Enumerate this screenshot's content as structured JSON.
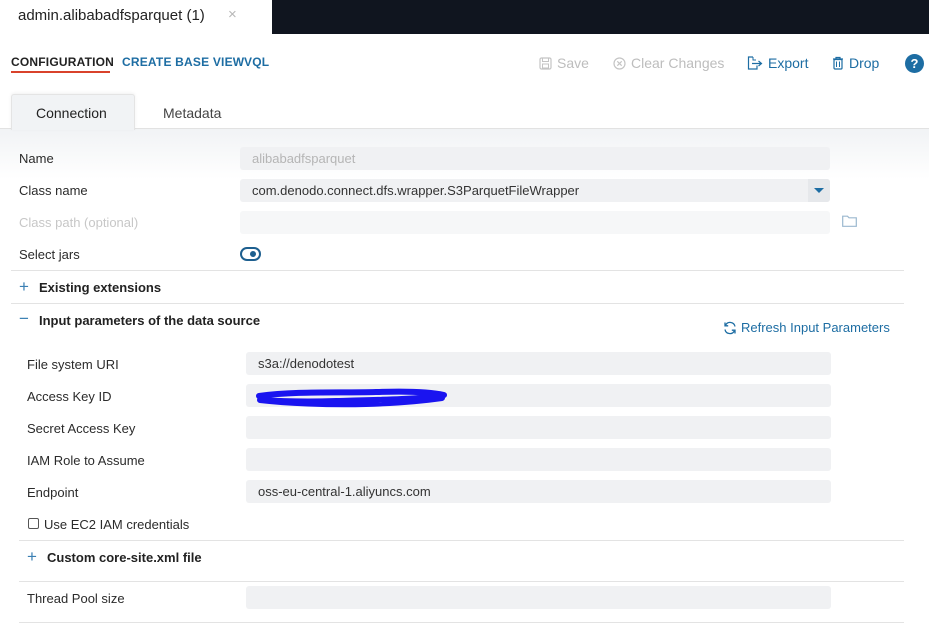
{
  "document_tab": {
    "title": "admin.alibabadfsparquet (1)",
    "close_glyph": "×"
  },
  "nav": {
    "configuration": "CONFIGURATION",
    "create_base_view": "CREATE BASE VIEW",
    "vql": "VQL"
  },
  "actions": {
    "save": "Save",
    "clear_changes": "Clear Changes",
    "export": "Export",
    "drop": "Drop",
    "help": "?"
  },
  "tabs": {
    "connection": "Connection",
    "metadata": "Metadata"
  },
  "form": {
    "name_label": "Name",
    "name_value": "alibabadfsparquet",
    "class_name_label": "Class name",
    "class_name_value": "com.denodo.connect.dfs.wrapper.S3ParquetFileWrapper",
    "class_path_label": "Class path (optional)",
    "class_path_value": "",
    "select_jars_label": "Select jars",
    "select_jars_on": true
  },
  "sections": {
    "existing_extensions": "Existing extensions",
    "input_parameters": "Input parameters of the data source",
    "refresh_label": "Refresh Input Parameters",
    "custom_core_site": "Custom core-site.xml file"
  },
  "params": {
    "fs_uri_label": "File system URI",
    "fs_uri_value": "s3a://denodotest",
    "access_key_label": "Access Key ID",
    "access_key_value": "",
    "secret_key_label": "Secret Access Key",
    "secret_key_value": "",
    "iam_role_label": "IAM Role to Assume",
    "iam_role_value": "",
    "endpoint_label": "Endpoint",
    "endpoint_value": "oss-eu-central-1.aliyuncs.com",
    "ec2_iam_label": "Use EC2 IAM credentials",
    "ec2_iam_checked": false,
    "thread_pool_label": "Thread Pool size",
    "thread_pool_value": ""
  },
  "colors": {
    "accent": "#1d6da3",
    "active_underline": "#d9422b",
    "topbar": "#10151f",
    "redaction": "#1a14f0"
  }
}
